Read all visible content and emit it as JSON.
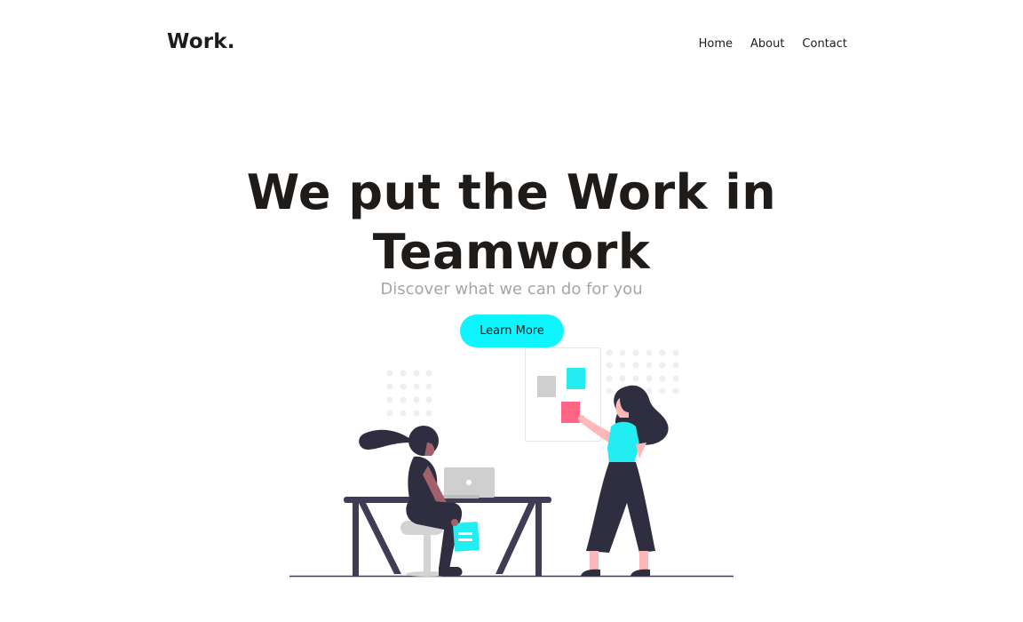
{
  "header": {
    "logo": "Work.",
    "nav": [
      {
        "label": "Home"
      },
      {
        "label": "About"
      },
      {
        "label": "Contact"
      }
    ]
  },
  "hero": {
    "title_line1": "We put the Work in",
    "title_line2": "Teamwork",
    "subtitle": "Discover what we can do for you",
    "cta_label": "Learn More"
  },
  "colors": {
    "accent": "#0ff5ff",
    "dark": "#1f1b18",
    "muted": "#a6a6a6",
    "figure_dark": "#2f2e41",
    "pink": "#ff6584"
  },
  "illustration": {
    "name": "teamwork-illustration"
  }
}
